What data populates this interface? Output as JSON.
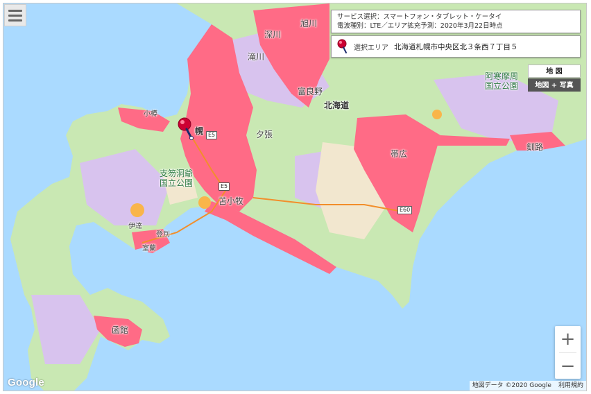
{
  "menu": {
    "icon": "hamburger-menu-icon"
  },
  "info": {
    "service_line": "サービス選択：スマートフォン・タブレット・ケータイ",
    "wave_line": "電波種別：LTE／エリア拡充予測：2020年3月22日時点"
  },
  "area": {
    "label": "選択エリア",
    "value": "北海道札幌市中央区北３条西７丁目５",
    "icon": "map-pin-icon"
  },
  "map_type": {
    "map": "地 図",
    "satellite": "地図 + 写真"
  },
  "zoom": {
    "in": "+",
    "out": "−"
  },
  "google_logo": "Google",
  "attribution": {
    "data": "地図データ ©2020 Google",
    "terms": "利用規約"
  },
  "places": {
    "asahikawa": "旭川",
    "takikawa": "滝川",
    "fukagawa": "深川",
    "furano": "富良野",
    "hokkaido": "北海道",
    "yubari": "夕張",
    "otaru": "小樽",
    "sapporo": "幌",
    "obihiro": "帯広",
    "kushiro": "釧路",
    "akan_park": "阿寒摩周\n国立公園",
    "shikotsu_park": "支笏洞爺\n国立公園",
    "tomakomai": "苫小牧",
    "date": "伊達",
    "muroran": "室蘭",
    "hakodate": "函館",
    "noboribetsu": "登別"
  },
  "roads": {
    "e5_a": "E5",
    "e5_b": "E5",
    "e60": "E60"
  },
  "colors": {
    "sea": "#aadaff",
    "coverage": "#ff6b86",
    "land_green": "#c9e8b3",
    "land_purple": "#d8c3ee",
    "land_beige": "#f2e7cf",
    "accent": "#cc0033"
  }
}
